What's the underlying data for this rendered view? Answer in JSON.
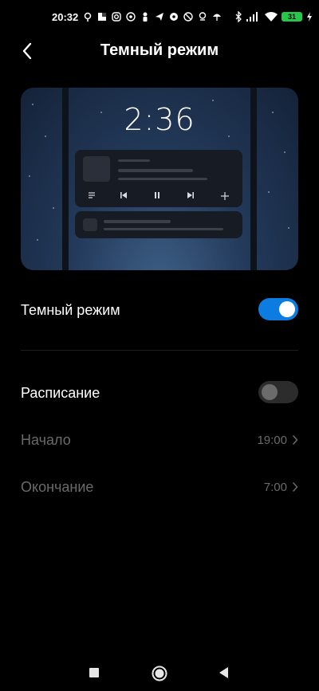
{
  "status_bar": {
    "time": "20:32",
    "battery": "31",
    "icons_left": [
      "location-pin-icon",
      "app-icon",
      "instagram-icon",
      "podcast-icon",
      "person-icon",
      "telegram-icon",
      "soccer-icon",
      "shield-icon",
      "location-icon",
      "umbrella-icon"
    ],
    "icons_right": [
      "bluetooth-icon",
      "signal-icon",
      "wifi-icon",
      "battery-icon",
      "charging-icon"
    ]
  },
  "header": {
    "title": "Темный режим",
    "back_icon": "chevron-left-icon"
  },
  "preview": {
    "clock": "2:36"
  },
  "settings": {
    "dark_mode": {
      "label": "Темный режим",
      "enabled": true
    },
    "schedule": {
      "label": "Расписание",
      "enabled": false
    },
    "start": {
      "label": "Начало",
      "value": "19:00"
    },
    "end": {
      "label": "Окончание",
      "value": "7:00"
    }
  },
  "colors": {
    "background": "#000000",
    "accent": "#0c7ce1",
    "dim_text": "#6a6a6a"
  },
  "navbar": {
    "icons": [
      "recent-apps-icon",
      "home-icon",
      "back-icon"
    ]
  }
}
